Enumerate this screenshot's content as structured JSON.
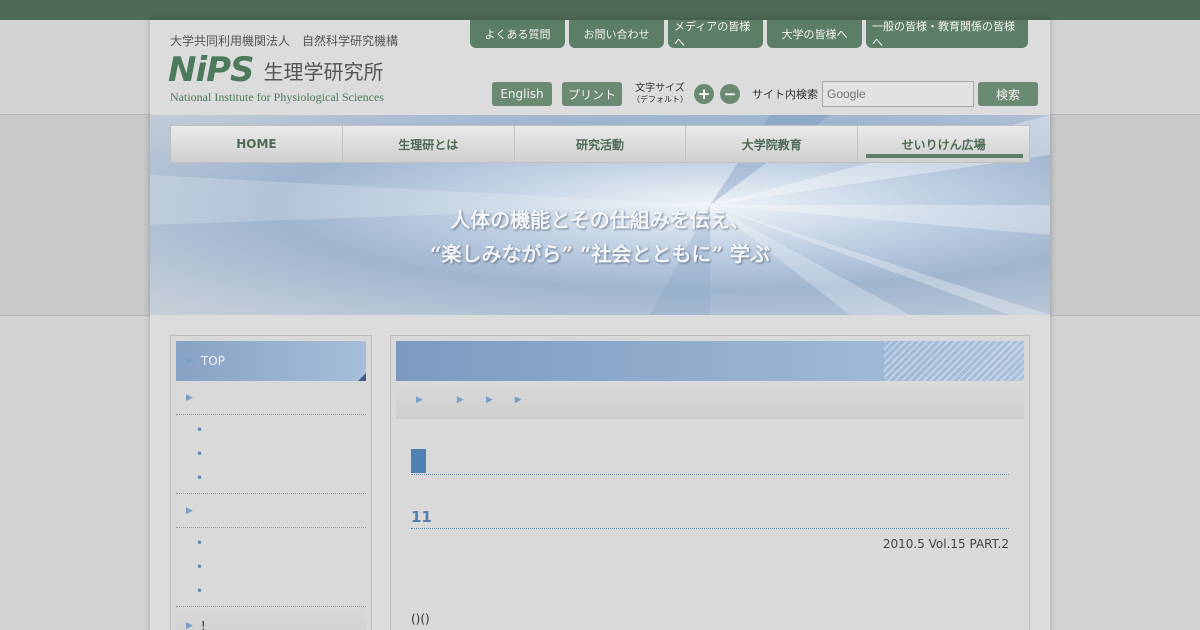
{
  "header": {
    "org": "大学共同利用機関法人　自然科学研究機構",
    "logo_mark": "NiPS",
    "logo_jp": "生理学研究所",
    "logo_en": "National Institute for Physiological Sciences"
  },
  "top_tabs": [
    "よくある質問",
    "お問い合わせ",
    "メディアの皆様へ",
    "大学の皆様へ",
    "一般の皆様・教育関係の皆様へ"
  ],
  "tools": {
    "english": "English",
    "print": "プリント",
    "font_size": "文字サイズ",
    "font_default": "（デフォルト）",
    "plus": "+",
    "minus": "−",
    "search_label": "サイト内検索",
    "search_placeholder": "Google",
    "search_button": "検索"
  },
  "global_nav": [
    "HOME",
    "生理研とは",
    "研究活動",
    "大学院教育",
    "せいりけん広場"
  ],
  "hero": {
    "line1": "人体の機能とその仕組みを伝え、",
    "line2": "“楽しみながら” “社会とともに” 学ぶ"
  },
  "sidebar": {
    "top_label": "TOP",
    "section_label": "!"
  },
  "main": {
    "heading": "11",
    "issue": "2010.5 Vol.15 PART.2",
    "paren": "()()"
  },
  "colors": {
    "brand_green": "#5d7e66",
    "accent_blue": "#4f80b4"
  }
}
